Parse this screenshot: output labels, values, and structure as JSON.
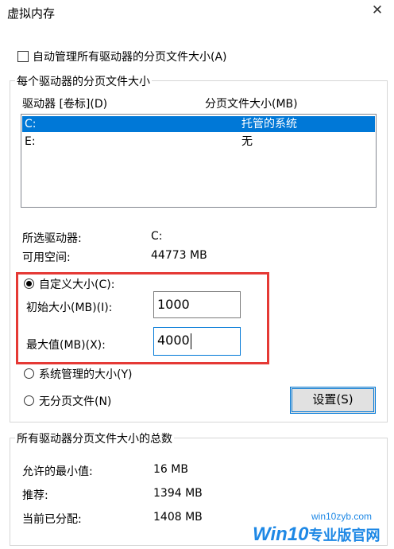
{
  "window": {
    "title": "虚拟内存",
    "close_symbol": "✕"
  },
  "auto_manage": {
    "label": "自动管理所有驱动器的分页文件大小(A)",
    "checked": false
  },
  "per_drive": {
    "legend": "每个驱动器的分页文件大小",
    "col_drive": "驱动器 [卷标](D)",
    "col_size": "分页文件大小(MB)",
    "drives": [
      {
        "drive": "C:",
        "size": "托管的系统",
        "selected": true
      },
      {
        "drive": "E:",
        "size": "无",
        "selected": false
      }
    ],
    "selected_drive_label": "所选驱动器:",
    "selected_drive_value": "C:",
    "free_space_label": "可用空间:",
    "free_space_value": "44773 MB",
    "custom_size_label": "自定义大小(C):",
    "initial_size_label": "初始大小(MB)(I):",
    "initial_size_value": "1000",
    "max_size_label": "最大值(MB)(X):",
    "max_size_value": "4000",
    "system_managed_label": "系统管理的大小(Y)",
    "no_paging_label": "无分页文件(N)",
    "set_button": "设置(S)",
    "selected_option": "custom"
  },
  "totals": {
    "legend": "所有驱动器分页文件大小的总数",
    "min_label": "允许的最小值:",
    "min_value": "16 MB",
    "recommended_label": "推荐:",
    "recommended_value": "1394 MB",
    "current_label": "当前已分配:",
    "current_value": "1408 MB"
  },
  "watermark": {
    "brand": "Win10",
    "suffix": "专业版官网",
    "url": "win10zyb.com"
  },
  "colors": {
    "selection": "#0078d7",
    "highlight_box": "#e53935",
    "watermark": "#1e88e5"
  }
}
